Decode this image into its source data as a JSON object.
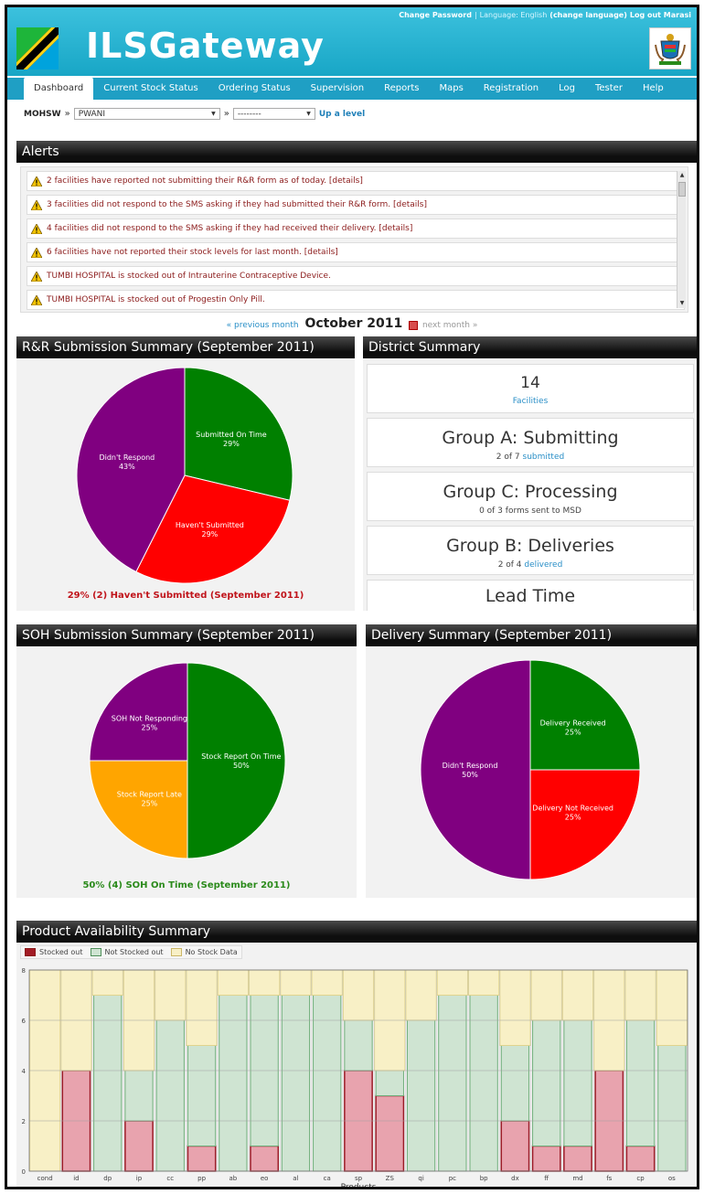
{
  "header": {
    "brand": "ILSGateway",
    "top_links": {
      "change_password": "Change Password",
      "separator": "|",
      "language_label": "Language: English",
      "change_language": "(change language)",
      "logout": "Log out Marasi"
    }
  },
  "nav": {
    "tabs": [
      {
        "label": "Dashboard",
        "active": true
      },
      {
        "label": "Current Stock Status",
        "active": false
      },
      {
        "label": "Ordering Status",
        "active": false
      },
      {
        "label": "Supervision",
        "active": false
      },
      {
        "label": "Reports",
        "active": false
      },
      {
        "label": "Maps",
        "active": false
      },
      {
        "label": "Registration",
        "active": false
      },
      {
        "label": "Log",
        "active": false
      },
      {
        "label": "Tester",
        "active": false
      },
      {
        "label": "Help",
        "active": false
      }
    ]
  },
  "breadcrumb": {
    "root": "MOHSW",
    "sep1": "»",
    "region_value": "PWANI",
    "sep2": "»",
    "district_value": "--------",
    "up_level": "Up a level"
  },
  "alerts": {
    "title": "Alerts",
    "items": [
      {
        "text": "2 facilities have reported not submitting their R&R form as of today. [details]"
      },
      {
        "text": "3 facilities did not respond to the SMS asking if they had submitted their R&R form. [details]"
      },
      {
        "text": "4 facilities did not respond to the SMS asking if they had received their delivery. [details]"
      },
      {
        "text": "6 facilities have not reported their stock levels for last month. [details]"
      },
      {
        "text": "TUMBI HOSPITAL is stocked out of Intrauterine Contraceptive Device."
      },
      {
        "text": "TUMBI HOSPITAL is stocked out of Progestin Only Pill."
      }
    ]
  },
  "month_nav": {
    "prev": "« previous month",
    "current": "October 2011",
    "next": "next month »"
  },
  "rr_summary": {
    "title": "R&R Submission Summary (September 2011)",
    "caption": "29% (2) Haven't Submitted (September 2011)",
    "caption_color": "#c0141b"
  },
  "district": {
    "title": "District Summary",
    "facilities_count": "14",
    "facilities_label": "Facilities",
    "group_a_title": "Group A: Submitting",
    "group_a_stat": "2 of 7",
    "group_a_link": "submitted",
    "group_c_title": "Group C: Processing",
    "group_c_stat": "0 of 3 forms sent to MSD",
    "group_b_title": "Group B: Deliveries",
    "group_b_stat": "2 of 4",
    "group_b_link": "delivered",
    "lead_time_title": "Lead Time"
  },
  "soh_summary": {
    "title": "SOH Submission Summary (September 2011)",
    "caption": "50% (4) SOH On Time (September 2011)",
    "caption_color": "#2a8a1a"
  },
  "delivery_summary": {
    "title": "Delivery Summary (September 2011)"
  },
  "product_summary": {
    "title": "Product Availability Summary"
  },
  "colors": {
    "accent": "#1f9fc4",
    "green": "#008000",
    "red": "#ff0000",
    "purple": "#800080",
    "orange": "#ffa500",
    "stocked_out": "#e8a3ae",
    "not_stocked_out": "#cfe4d2",
    "no_data": "#f8f0c6"
  },
  "chart_data": [
    {
      "type": "pie",
      "title": "R&R Submission Summary (September 2011)",
      "slices": [
        {
          "label": "Submitted On Time",
          "pct_label": "29%",
          "value": 29,
          "color": "#008000"
        },
        {
          "label": "Haven't Submitted",
          "pct_label": "29%",
          "value": 29,
          "color": "#ff0000"
        },
        {
          "label": "Didn't Respond",
          "pct_label": "43%",
          "value": 43,
          "color": "#800080"
        }
      ]
    },
    {
      "type": "pie",
      "title": "SOH Submission Summary (September 2011)",
      "slices": [
        {
          "label": "Stock Report On Time",
          "pct_label": "50%",
          "value": 50,
          "color": "#008000"
        },
        {
          "label": "Stock Report Late",
          "pct_label": "25%",
          "value": 25,
          "color": "#ffa500"
        },
        {
          "label": "SOH Not Responding",
          "pct_label": "25%",
          "value": 25,
          "color": "#800080"
        }
      ]
    },
    {
      "type": "pie",
      "title": "Delivery Summary (September 2011)",
      "slices": [
        {
          "label": "Delivery Received",
          "pct_label": "25%",
          "value": 25,
          "color": "#008000"
        },
        {
          "label": "Delivery Not Received",
          "pct_label": "25%",
          "value": 25,
          "color": "#ff0000"
        },
        {
          "label": "Didn't Respond",
          "pct_label": "50%",
          "value": 50,
          "color": "#800080"
        }
      ]
    },
    {
      "type": "bar",
      "title": "Product Availability Summary",
      "stacked": true,
      "xlabel": "Products",
      "ylabel": "",
      "ylim": [
        0,
        8
      ],
      "yticks": [
        0,
        2,
        4,
        6,
        8
      ],
      "categories": [
        "cond",
        "id",
        "dp",
        "ip",
        "cc",
        "pp",
        "ab",
        "eo",
        "al",
        "ca",
        "sp",
        "ZS",
        "qi",
        "pc",
        "bp",
        "dx",
        "ff",
        "md",
        "fs",
        "cp",
        "os"
      ],
      "series": [
        {
          "name": "Stocked out",
          "color": "#e8a3ae",
          "values": [
            0,
            4,
            0,
            2,
            0,
            1,
            0,
            1,
            0,
            0,
            4,
            3,
            0,
            0,
            0,
            2,
            1,
            1,
            4,
            1,
            0
          ]
        },
        {
          "name": "Not Stocked out",
          "color": "#cfe4d2",
          "values": [
            0,
            0,
            7,
            2,
            6,
            4,
            7,
            6,
            7,
            7,
            2,
            1,
            6,
            7,
            7,
            3,
            5,
            5,
            0,
            5,
            5
          ]
        },
        {
          "name": "No Stock Data",
          "color": "#f8f0c6",
          "values": [
            8,
            4,
            1,
            4,
            2,
            3,
            1,
            1,
            1,
            1,
            2,
            4,
            2,
            1,
            1,
            3,
            2,
            2,
            4,
            2,
            3
          ]
        }
      ],
      "legend": "top-left",
      "grid": true
    }
  ]
}
